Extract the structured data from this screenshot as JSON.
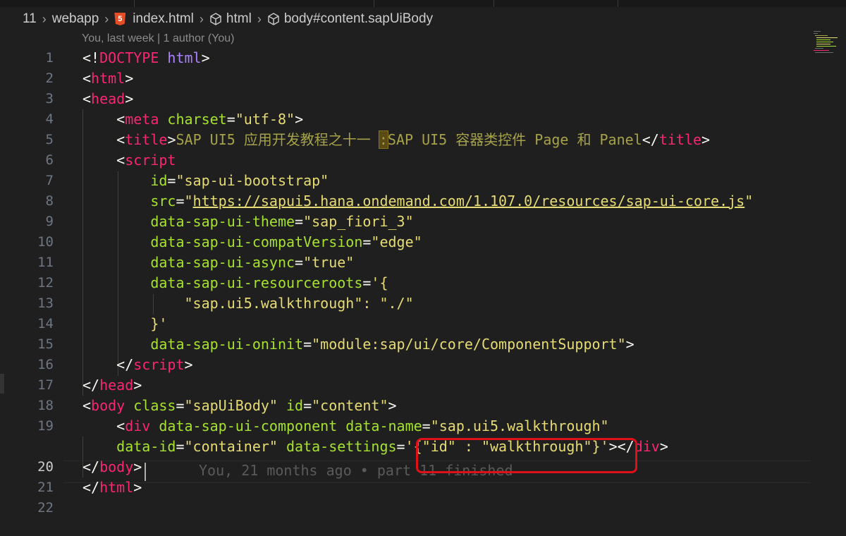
{
  "breadcrumb": {
    "line_count": "11",
    "folder": "webapp",
    "file": "index.html",
    "node1": "html",
    "node2": "body#content.sapUiBody",
    "html5_badge": "5"
  },
  "codelens": "You, last week | 1 author (You)",
  "blame_annotation": "You, 21 months ago • part 11 finished",
  "line_numbers": [
    "1",
    "2",
    "3",
    "4",
    "5",
    "6",
    "7",
    "8",
    "9",
    "10",
    "11",
    "12",
    "13",
    "14",
    "15",
    "16",
    "17",
    "18",
    "19",
    "",
    "20",
    "21",
    "22"
  ],
  "code": {
    "l1a": "<!",
    "l1b": "DOCTYPE",
    "l1c": " html",
    "l1d": ">",
    "html_open": "html",
    "head_open": "head",
    "meta": "meta",
    "charset_attr": " charset",
    "charset_val": "\"utf-8\"",
    "title_tag": "title",
    "title_text_a": "SAP UI5 应用开发教程之十一 ",
    "title_colon": ":",
    "title_text_b": "SAP UI5 容器类控件 Page 和 Panel",
    "script_tag": "script",
    "id_attr": "id",
    "id_val": "\"sap-ui-bootstrap\"",
    "src_attr": "src",
    "src_q1": "\"",
    "src_url": "https://sapui5.hana.ondemand.com/1.107.0/resources/sap-ui-core.js",
    "src_q2": "\"",
    "theme_attr": "data-sap-ui-theme",
    "theme_val": "\"sap_fiori_3\"",
    "compat_attr": "data-sap-ui-compatVersion",
    "compat_val": "\"edge\"",
    "async_attr": "data-sap-ui-async",
    "async_val": "\"true\"",
    "rr_attr": "data-sap-ui-resourceroots",
    "rr_val_open": "'{",
    "rr_inner": "\"sap.ui5.walkthrough\": \"./\"",
    "rr_val_close": "}'",
    "oninit_attr": "data-sap-ui-oninit",
    "oninit_val": "\"module:sap/ui/core/ComponentSupport\"",
    "script_close": "script",
    "head_close": "head",
    "body_tag": "body",
    "class_attr": " class",
    "class_val": "\"sapUiBody\"",
    "idc_attr": " id",
    "idc_val": "\"content\"",
    "div_tag": "div",
    "comp_attr": " data-sap-ui-component",
    "dname_attr": " data-name",
    "dname_val": "\"sap.ui5.walkthrough\"",
    "did_attr": "data-id",
    "did_val": "\"container\"",
    "dset_attr": " data-settings",
    "dset_val": "'{\"id\" : \"walkthrough\"}'",
    "div_close": "div",
    "body_close": "body",
    "html_close": "html"
  }
}
